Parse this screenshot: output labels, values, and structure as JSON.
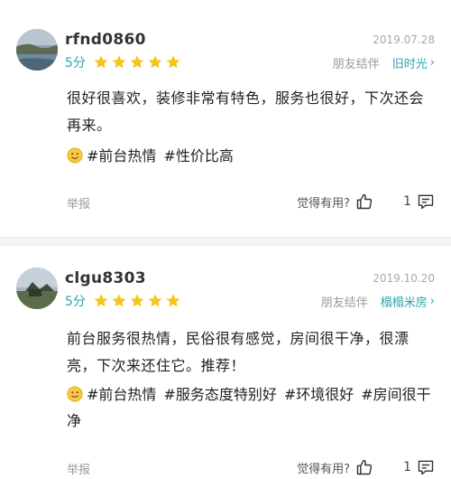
{
  "reviews": [
    {
      "username": "rfnd0860",
      "date": "2019.07.28",
      "score": "5分",
      "stars": 5,
      "source_prefix": "朋友结伴",
      "source_name": "旧时光",
      "text": "很好很喜欢，装修非常有特色，服务也很好，下次还会再来。",
      "tags": [
        "#前台热情",
        "#性价比高"
      ],
      "report_label": "举报",
      "useful_label": "觉得有用?",
      "comment_count": "1"
    },
    {
      "username": "clgu8303",
      "date": "2019.10.20",
      "score": "5分",
      "stars": 5,
      "source_prefix": "朋友结伴",
      "source_name": "榻榻米房",
      "text": "前台服务很热情，民俗很有感觉，房间很干净，很漂亮，下次来还住它。推荐！",
      "tags": [
        "#前台热情",
        "#服务态度特别好",
        "#环境很好",
        "#房间很干净"
      ],
      "report_label": "举报",
      "useful_label": "觉得有用?",
      "comment_count": "1"
    }
  ],
  "colors": {
    "accent": "#2aa6ae",
    "star": "#f5c518",
    "muted": "#9a9a9a"
  }
}
